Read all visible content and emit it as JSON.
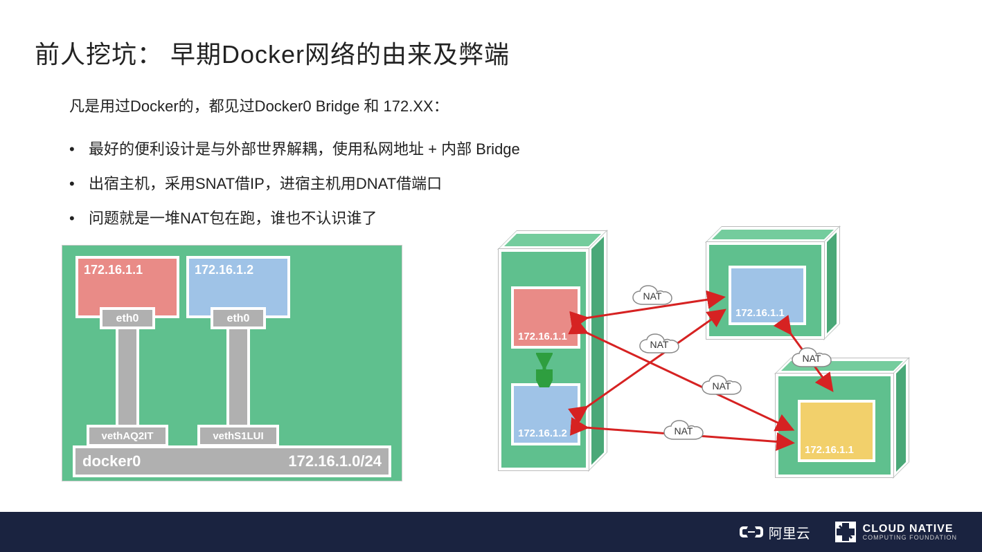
{
  "title": "前人挖坑：  早期Docker网络的由来及弊端",
  "intro": "凡是用过Docker的，都见过Docker0 Bridge 和 172.XX：",
  "bullets": [
    "最好的便利设计是与外部世界解耦，使用私网地址 + 内部  Bridge",
    "出宿主机，采用SNAT借IP，进宿主机用DNAT借端口",
    "问题就是一堆NAT包在跑，谁也不认识谁了"
  ],
  "left": {
    "c1_ip": "172.16.1.1",
    "c2_ip": "172.16.1.2",
    "eth": "eth0",
    "veth1": "vethAQ2IT",
    "veth2": "vethS1LUI",
    "bridge": "docker0",
    "subnet": "172.16.1.0/24"
  },
  "right": {
    "hostA": {
      "pod1": "172.16.1.1",
      "pod2": "172.16.1.2"
    },
    "hostB": {
      "pod1": "172.16.1.1"
    },
    "hostC": {
      "pod1": "172.16.1.1"
    },
    "nat": "NAT"
  },
  "footer": {
    "aliyun": "阿里云",
    "cncf1": "CLOUD NATIVE",
    "cncf2": "COMPUTING FOUNDATION"
  }
}
